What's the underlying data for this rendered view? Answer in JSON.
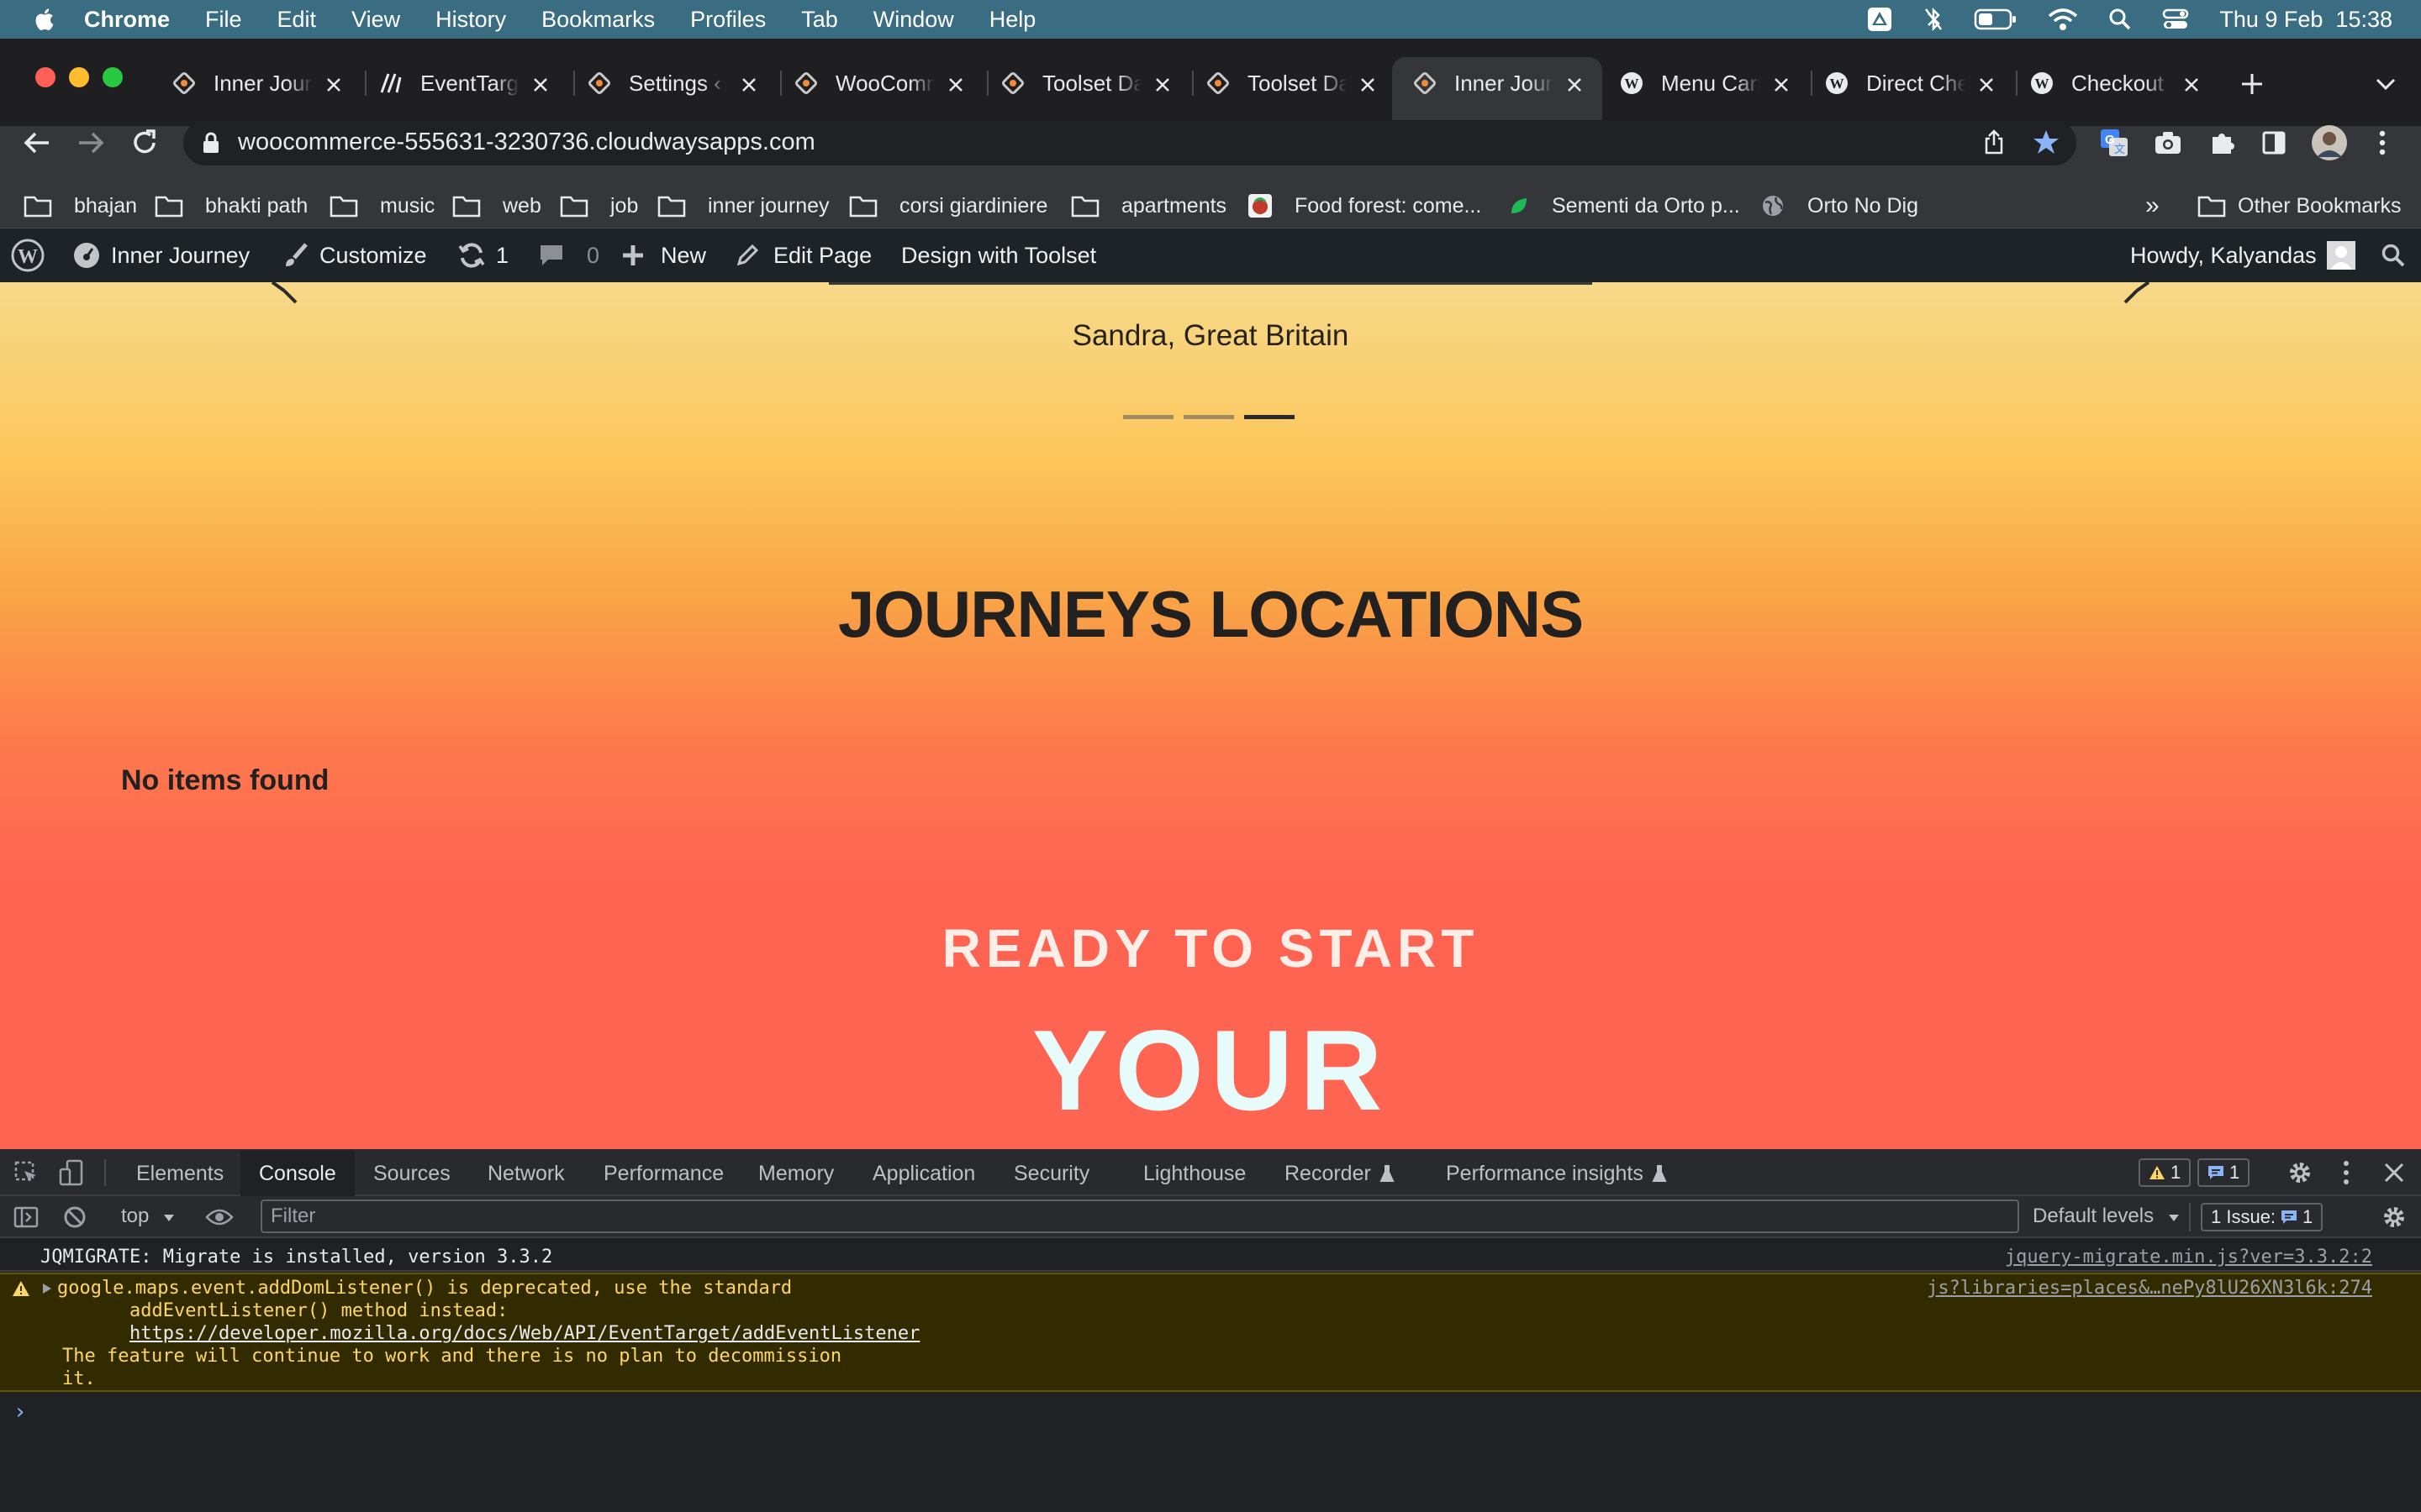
{
  "menubar": {
    "app": "Chrome",
    "items": [
      "File",
      "Edit",
      "View",
      "History",
      "Bookmarks",
      "Profiles",
      "Tab",
      "Window",
      "Help"
    ],
    "clock": "Thu 9 Feb  15:38"
  },
  "tabs": [
    {
      "title": "Inner Journey",
      "icon": "toolset-icon"
    },
    {
      "title": "EventTarget",
      "icon": "mdn-icon"
    },
    {
      "title": "Settings ‹ Inner",
      "icon": "toolset-icon"
    },
    {
      "title": "WooCommerce",
      "icon": "toolset-icon"
    },
    {
      "title": "Toolset Dashboard",
      "icon": "toolset-icon"
    },
    {
      "title": "Toolset Dashboard",
      "icon": "toolset-icon"
    },
    {
      "title": "Inner Journey",
      "icon": "toolset-icon",
      "active": true
    },
    {
      "title": "Menu Cart",
      "icon": "wordpress-icon"
    },
    {
      "title": "Direct Checkout",
      "icon": "wordpress-icon"
    },
    {
      "title": "Checkout",
      "icon": "wordpress-icon"
    }
  ],
  "url": "woocommerce-555631-3230736.cloudwaysapps.com",
  "bookmarks": [
    {
      "label": "bhajan",
      "icon": "folder-icon"
    },
    {
      "label": "bhakti path",
      "icon": "folder-icon"
    },
    {
      "label": "music",
      "icon": "folder-icon"
    },
    {
      "label": "web",
      "icon": "folder-icon"
    },
    {
      "label": "job",
      "icon": "folder-icon"
    },
    {
      "label": "inner journey",
      "icon": "folder-icon"
    },
    {
      "label": "corsi giardiniere",
      "icon": "folder-icon"
    },
    {
      "label": "apartments",
      "icon": "folder-icon"
    },
    {
      "label": "Food forest: come...",
      "icon": "site-icon"
    },
    {
      "label": "Sementi da Orto p...",
      "icon": "leaf-icon"
    },
    {
      "label": "Orto No Dig",
      "icon": "globe-icon"
    }
  ],
  "bookmarks_more": "»",
  "other_bookmarks": "Other Bookmarks",
  "wpbar": {
    "site": "Inner Journey",
    "customize": "Customize",
    "updates": "1",
    "comments": "0",
    "new": "New",
    "edit_page": "Edit Page",
    "design": "Design with Toolset",
    "howdy": "Howdy, Kalyandas"
  },
  "page": {
    "author": "Sandra, Great Britain",
    "slider_active_index": 2,
    "slider_count": 3,
    "section_title": "JOURNEYS LOCATIONS",
    "no_items": "No items found",
    "ready": "READY TO START",
    "your": "YOUR"
  },
  "devtools": {
    "tabs": [
      "Elements",
      "Console",
      "Sources",
      "Network",
      "Performance",
      "Memory",
      "Application",
      "Security",
      "Lighthouse",
      "Recorder",
      "Performance insights"
    ],
    "active_tab": "Console",
    "warnings": "1",
    "messages": "1",
    "context": "top",
    "filter_placeholder": "Filter",
    "levels": "Default levels",
    "issues": "1 Issue:",
    "issues_count": "1",
    "log1": "JQMIGRATE: Migrate is installed, version 3.3.2",
    "log1_src": "jquery-migrate.min.js?ver=3.3.2:2",
    "warn_line1": "google.maps.event.addDomListener() is deprecated, use the standard",
    "warn_line2": "addEventListener() method instead:",
    "warn_link": "https://developer.mozilla.org/docs/Web/API/EventTarget/addEventListener",
    "warn_line3": "The feature will continue to work and there is no plan to decommission",
    "warn_line4": "it.",
    "warn_src": "js?libraries=places&…nePy8lU26XN3l6k:274",
    "prompt": "›"
  }
}
